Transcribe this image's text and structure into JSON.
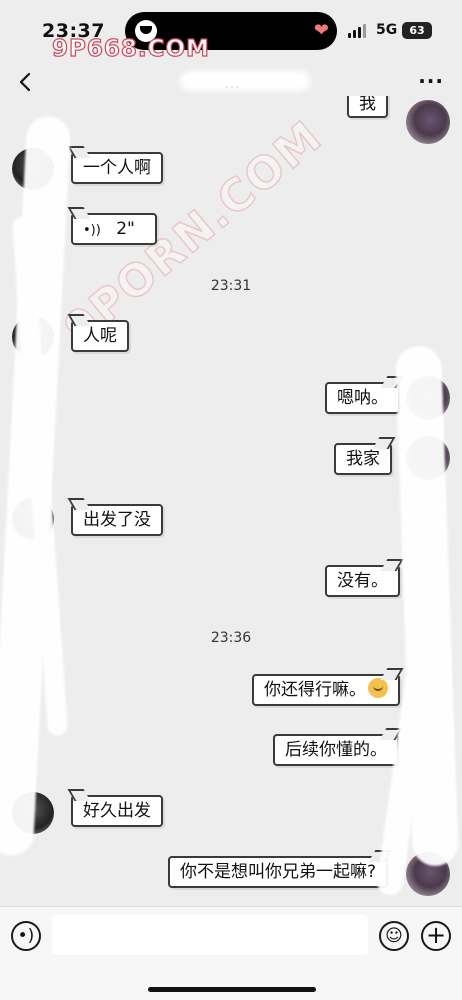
{
  "status_bar": {
    "time": "23:37",
    "network": "5G",
    "battery": "63",
    "watermark": "9P668.COM",
    "watermark_diag": "9PORN.COM"
  },
  "nav": {
    "title": "…",
    "more_label": "···"
  },
  "messages": [
    {
      "side": "right",
      "text": "我"
    },
    {
      "side": "left",
      "text": "一个人啊"
    },
    {
      "side": "left",
      "type": "voice",
      "text": "2\""
    },
    {
      "type": "time",
      "text": "23:31"
    },
    {
      "side": "left",
      "text": "人呢"
    },
    {
      "side": "right",
      "text": "嗯呐。"
    },
    {
      "side": "right",
      "text": "我家"
    },
    {
      "side": "left",
      "text": "出发了没"
    },
    {
      "side": "right",
      "text": "没有。"
    },
    {
      "type": "time",
      "text": "23:36"
    },
    {
      "side": "right",
      "text": "你还得行嘛。",
      "emoji": "cat-emoji"
    },
    {
      "side": "right",
      "text": "后续你懂的。"
    },
    {
      "side": "left",
      "text": "好久出发"
    },
    {
      "side": "right",
      "text": "你不是想叫你兄弟一起嘛?"
    }
  ],
  "input_bar": {
    "placeholder": ""
  },
  "colors": {
    "background": "#ededed",
    "bubble": "#ffffff",
    "bubble_border": "#3a3a3a",
    "watermark": "#d0455a"
  }
}
